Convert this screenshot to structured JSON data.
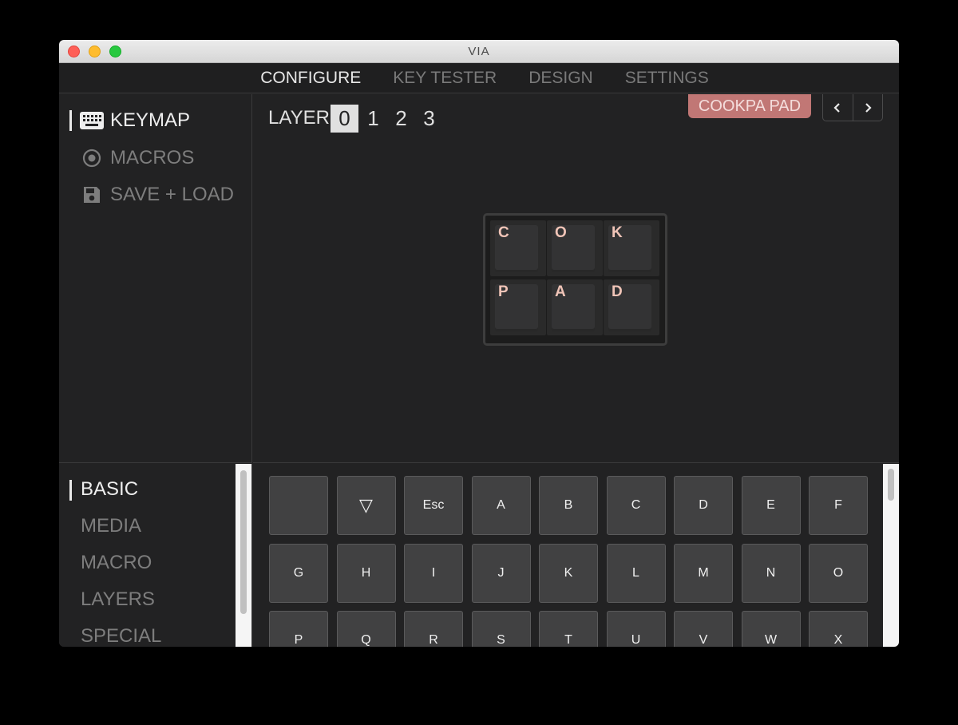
{
  "window": {
    "title": "VIA"
  },
  "menu": [
    {
      "label": "CONFIGURE",
      "active": true
    },
    {
      "label": "KEY TESTER",
      "active": false
    },
    {
      "label": "DESIGN",
      "active": false
    },
    {
      "label": "SETTINGS",
      "active": false
    }
  ],
  "sidebar": {
    "items": [
      {
        "label": "KEYMAP",
        "icon": "keyboard-icon",
        "active": true
      },
      {
        "label": "MACROS",
        "icon": "record-icon",
        "active": false
      },
      {
        "label": "SAVE + LOAD",
        "icon": "floppy-disk-icon",
        "active": false
      }
    ]
  },
  "layers": {
    "label": "LAYER",
    "numbers": [
      "0",
      "1",
      "2",
      "3"
    ],
    "selected": "0"
  },
  "keyboard": {
    "name": "COOKPA PAD",
    "keys": [
      [
        "C",
        "O",
        "K"
      ],
      [
        "P",
        "A",
        "D"
      ]
    ]
  },
  "categories": {
    "items": [
      "BASIC",
      "MEDIA",
      "MACRO",
      "LAYERS",
      "SPECIAL"
    ],
    "selected": "BASIC"
  },
  "keycodes": [
    [
      "",
      "▽",
      "Esc",
      "A",
      "B",
      "C",
      "D",
      "E",
      "F"
    ],
    [
      "G",
      "H",
      "I",
      "J",
      "K",
      "L",
      "M",
      "N",
      "O"
    ],
    [
      "P",
      "Q",
      "R",
      "S",
      "T",
      "U",
      "V",
      "W",
      "X"
    ]
  ],
  "colors": {
    "accent": "#c17775",
    "key_legend": "#f0c4b7",
    "background": "#222223"
  }
}
